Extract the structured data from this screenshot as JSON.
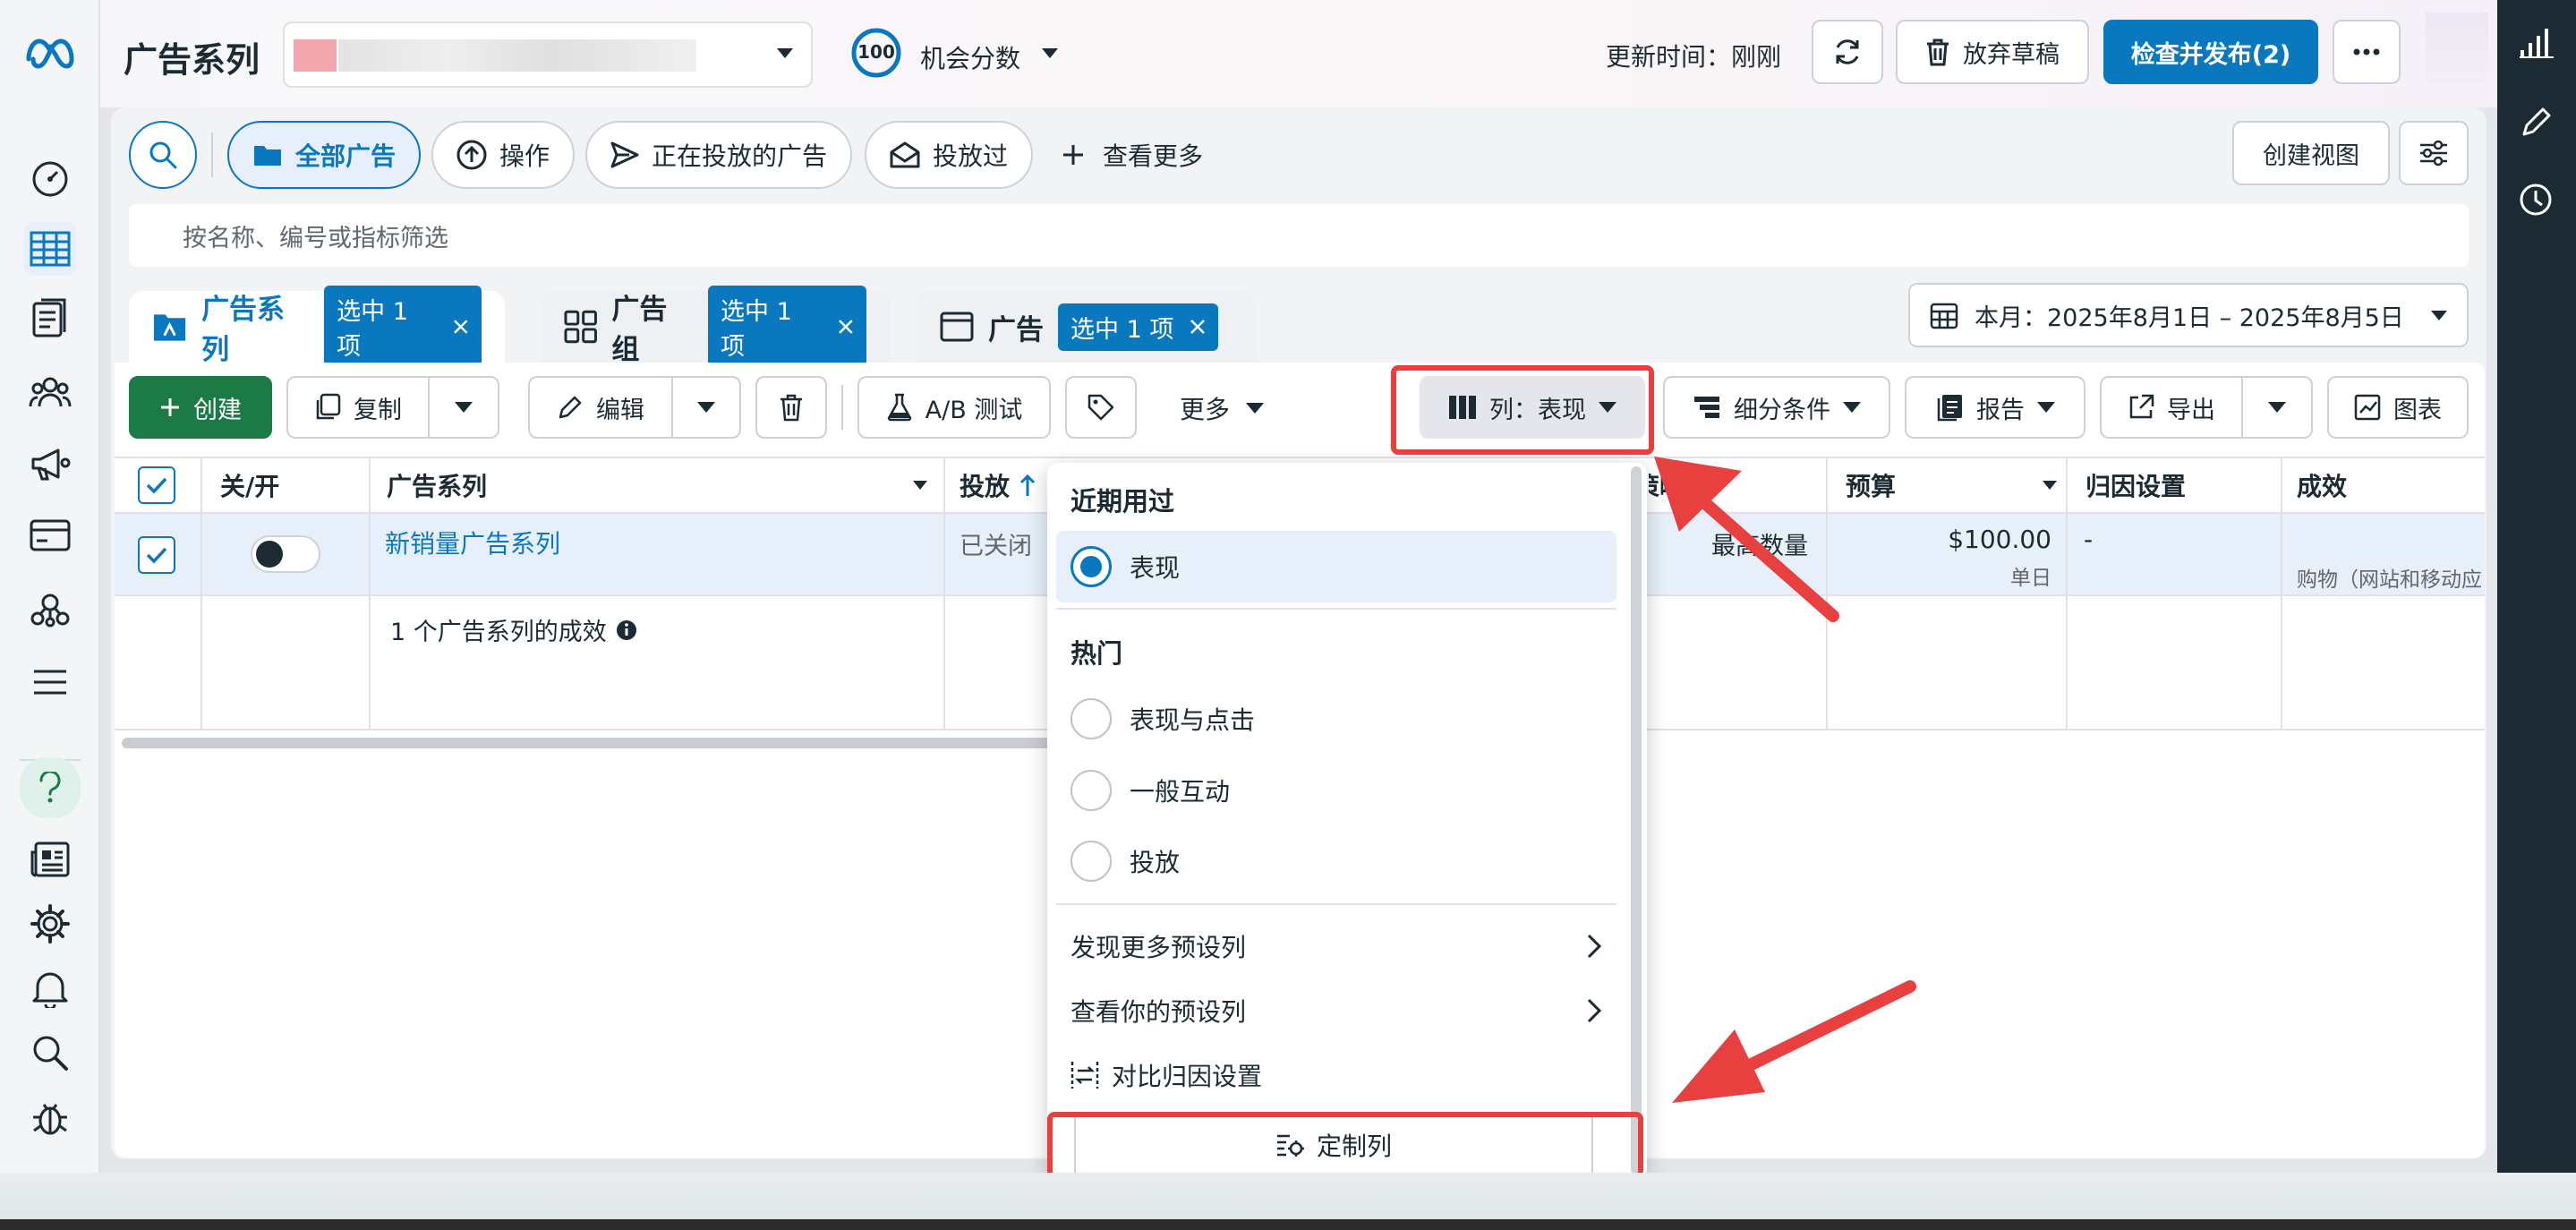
{
  "header": {
    "title": "广告系列",
    "score_value": "100",
    "score_label": "机会分数",
    "updated_text": "更新时间：刚刚",
    "discard_label": "放弃草稿",
    "publish_label": "检查并发布(2)"
  },
  "filters": {
    "all_ads": "全部广告",
    "operations": "操作",
    "active_ads": "正在投放的广告",
    "delivered": "投放过",
    "see_more": "查看更多",
    "create_view": "创建视图",
    "search_placeholder": "按名称、编号或指标筛选"
  },
  "tabs": [
    {
      "label": "广告系列",
      "tag": "选中 1 项"
    },
    {
      "label": "广告组",
      "tag": "选中 1 项"
    },
    {
      "label": "广告",
      "tag": "选中 1 项"
    }
  ],
  "date_range": "本月：2025年8月1日 – 2025年8月5日",
  "toolbar": {
    "create": "创建",
    "copy": "复制",
    "edit": "编辑",
    "ab_test": "A/B 测试",
    "more": "更多",
    "columns": "列：表现",
    "breakdown": "细分条件",
    "reports": "报告",
    "export": "导出",
    "charts": "图表"
  },
  "table": {
    "headers": {
      "toggle": "关/开",
      "campaign": "广告系列",
      "delivery": "投放",
      "strategy": "策略",
      "budget": "预算",
      "attribution": "归因设置",
      "results": "成效"
    },
    "row": {
      "name": "新销量广告系列",
      "delivery": "已关闭",
      "strategy": "最高数量",
      "budget": "$100.00",
      "budget_type": "单日",
      "attribution": "-",
      "results": "购物（网站和移动应"
    },
    "summary": "1 个广告系列的成效"
  },
  "dropdown": {
    "recent_header": "近期用过",
    "recent_item": "表现",
    "popular_header": "热门",
    "popular_items": [
      "表现与点击",
      "一般互动",
      "投放"
    ],
    "discover_more": "发现更多预设列",
    "view_yours": "查看你的预设列",
    "compare_attr": "对比归因设置",
    "customize": "定制列"
  },
  "colors": {
    "accent": "#0a78be",
    "create_green": "#1b7a45",
    "annotation_red": "#e8403f"
  }
}
